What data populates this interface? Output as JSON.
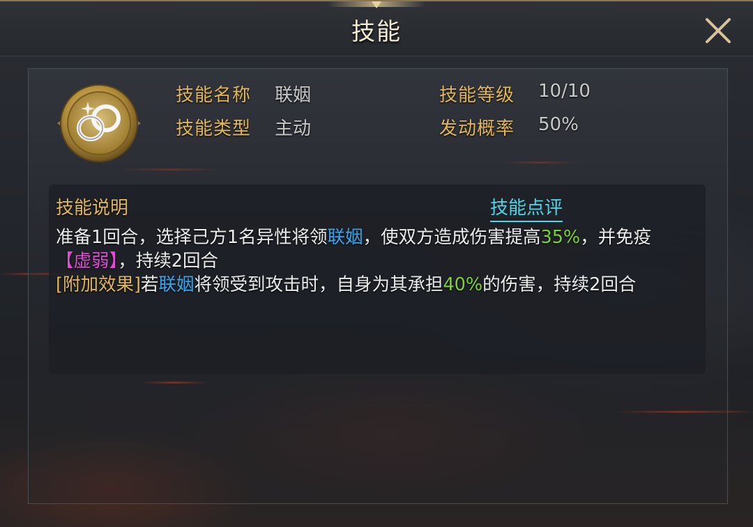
{
  "window": {
    "title": "技能",
    "close_icon": "close-icon"
  },
  "skill": {
    "icon": "linked-rings-icon",
    "name_label": "技能名称",
    "name": "联姻",
    "type_label": "技能类型",
    "type": "主动",
    "level_label": "技能等级",
    "level": "10/10",
    "rate_label": "发动概率",
    "rate": "50%"
  },
  "description": {
    "title": "技能说明",
    "review_link": "技能点评",
    "line1": {
      "seg1": "准备1回合，选择己方1名异性将领",
      "kw1": "联姻",
      "seg2": "，使双方造成伤害提高",
      "pct1": "35%",
      "seg3": "，并免疫",
      "debuff": "【虚弱】",
      "seg4": "，持续2回合"
    },
    "line2": {
      "tag": "[附加效果]",
      "seg1": "若",
      "kw1": "联姻",
      "seg2": "将领受到攻击时，自身为其承担",
      "pct1": "40%",
      "seg3": "的伤害，持续2回合"
    }
  },
  "colors": {
    "gold_label": "#e2b659",
    "keyword_blue": "#38a8ee",
    "percent_green": "#7ed230",
    "debuff_pink": "#e24bd6",
    "link_cyan": "#4fd4e6"
  }
}
